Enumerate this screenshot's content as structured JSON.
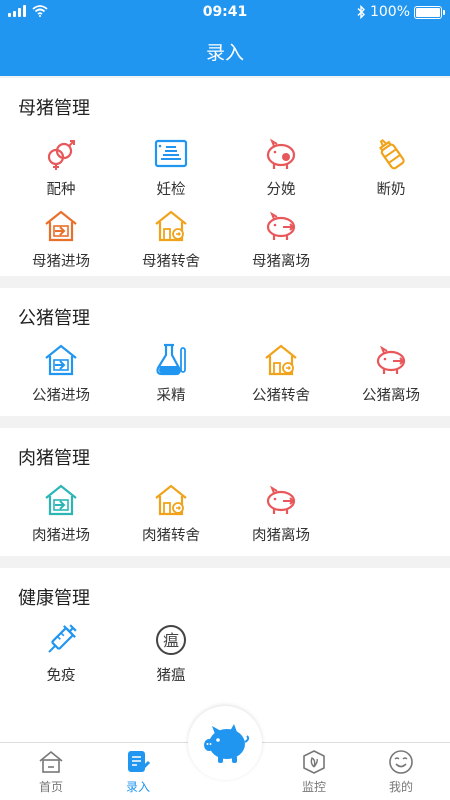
{
  "status": {
    "time": "09:41",
    "battery": "100%"
  },
  "header": {
    "title": "录入"
  },
  "sections": [
    {
      "title": "母猪管理",
      "items": [
        {
          "label": "配种",
          "icon": "gender-rings-icon"
        },
        {
          "label": "妊检",
          "icon": "ultrasound-icon"
        },
        {
          "label": "分娩",
          "icon": "piglet-icon"
        },
        {
          "label": "断奶",
          "icon": "bottle-icon"
        },
        {
          "label": "母猪进场",
          "icon": "barn-enter-icon"
        },
        {
          "label": "母猪转舍",
          "icon": "barn-transfer-icon"
        },
        {
          "label": "母猪离场",
          "icon": "pig-exit-icon"
        }
      ]
    },
    {
      "title": "公猪管理",
      "items": [
        {
          "label": "公猪进场",
          "icon": "barn-enter-icon"
        },
        {
          "label": "采精",
          "icon": "flask-icon"
        },
        {
          "label": "公猪转舍",
          "icon": "barn-transfer-icon"
        },
        {
          "label": "公猪离场",
          "icon": "pig-exit-icon"
        }
      ]
    },
    {
      "title": "肉猪管理",
      "items": [
        {
          "label": "肉猪进场",
          "icon": "barn-enter-icon"
        },
        {
          "label": "肉猪转舍",
          "icon": "barn-transfer-icon"
        },
        {
          "label": "肉猪离场",
          "icon": "pig-exit-icon"
        }
      ]
    },
    {
      "title": "健康管理",
      "items": [
        {
          "label": "免疫",
          "icon": "syringe-icon"
        },
        {
          "label": "猪瘟",
          "icon": "plague-icon",
          "glyph": "瘟"
        }
      ]
    }
  ],
  "tabs": [
    {
      "label": "首页",
      "icon": "home-icon"
    },
    {
      "label": "录入",
      "icon": "edit-icon",
      "active": true
    },
    {
      "label": "监控",
      "icon": "monitor-icon"
    },
    {
      "label": "我的",
      "icon": "smiley-icon"
    }
  ],
  "colors": {
    "primary": "#2196f0",
    "red": "#e8575a",
    "orange": "#f0a31a",
    "teal": "#2bb5b5"
  }
}
